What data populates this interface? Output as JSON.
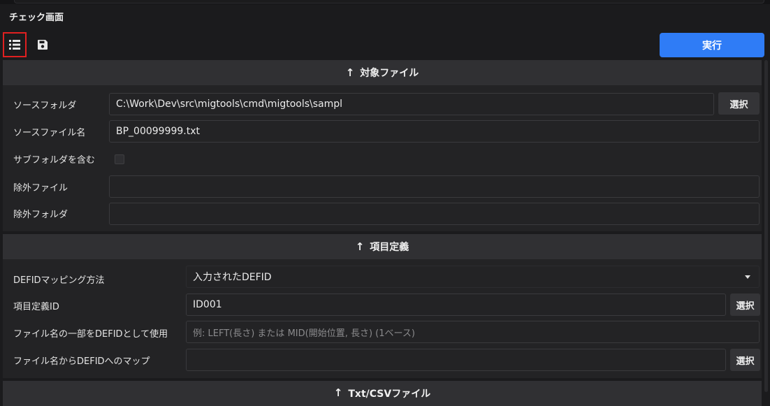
{
  "window": {
    "title": "チェック画面"
  },
  "toolbar": {
    "list_icon": "list-icon",
    "save_icon": "save-icon",
    "run_label": "実行"
  },
  "sections": {
    "target": {
      "header": "対象ファイル",
      "source_folder_label": "ソースフォルダ",
      "source_folder_value": "C:\\Work\\Dev\\src\\migtools\\cmd\\migtools\\sampl",
      "source_folder_button": "選択",
      "source_file_label": "ソースファイル名",
      "source_file_value": "BP_00099999.txt",
      "include_subfolders_label": "サブフォルダを含む",
      "include_subfolders_checked": false,
      "exclude_files_label": "除外ファイル",
      "exclude_files_value": "",
      "exclude_folders_label": "除外フォルダ",
      "exclude_folders_value": ""
    },
    "definition": {
      "header": "項目定義",
      "defid_mapping_label": "DEFIDマッピング方法",
      "defid_mapping_value": "入力されたDEFID",
      "item_def_id_label": "項目定義ID",
      "item_def_id_value": "ID001",
      "item_def_id_button": "選択",
      "filename_part_label": "ファイル名の一部をDEFIDとして使用",
      "filename_part_placeholder": "例: LEFT(長さ) または  MID(開始位置, 長さ) (1ベース)",
      "filename_map_label": "ファイル名からDEFIDへのマップ",
      "filename_map_value": "",
      "filename_map_button": "選択"
    },
    "txtcsv": {
      "header": "Txt/CSVファイル"
    }
  },
  "colors": {
    "accent": "#2f7cf6",
    "highlight_border": "#e02020",
    "background": "#1b1b1d",
    "section_header": "#303033"
  }
}
